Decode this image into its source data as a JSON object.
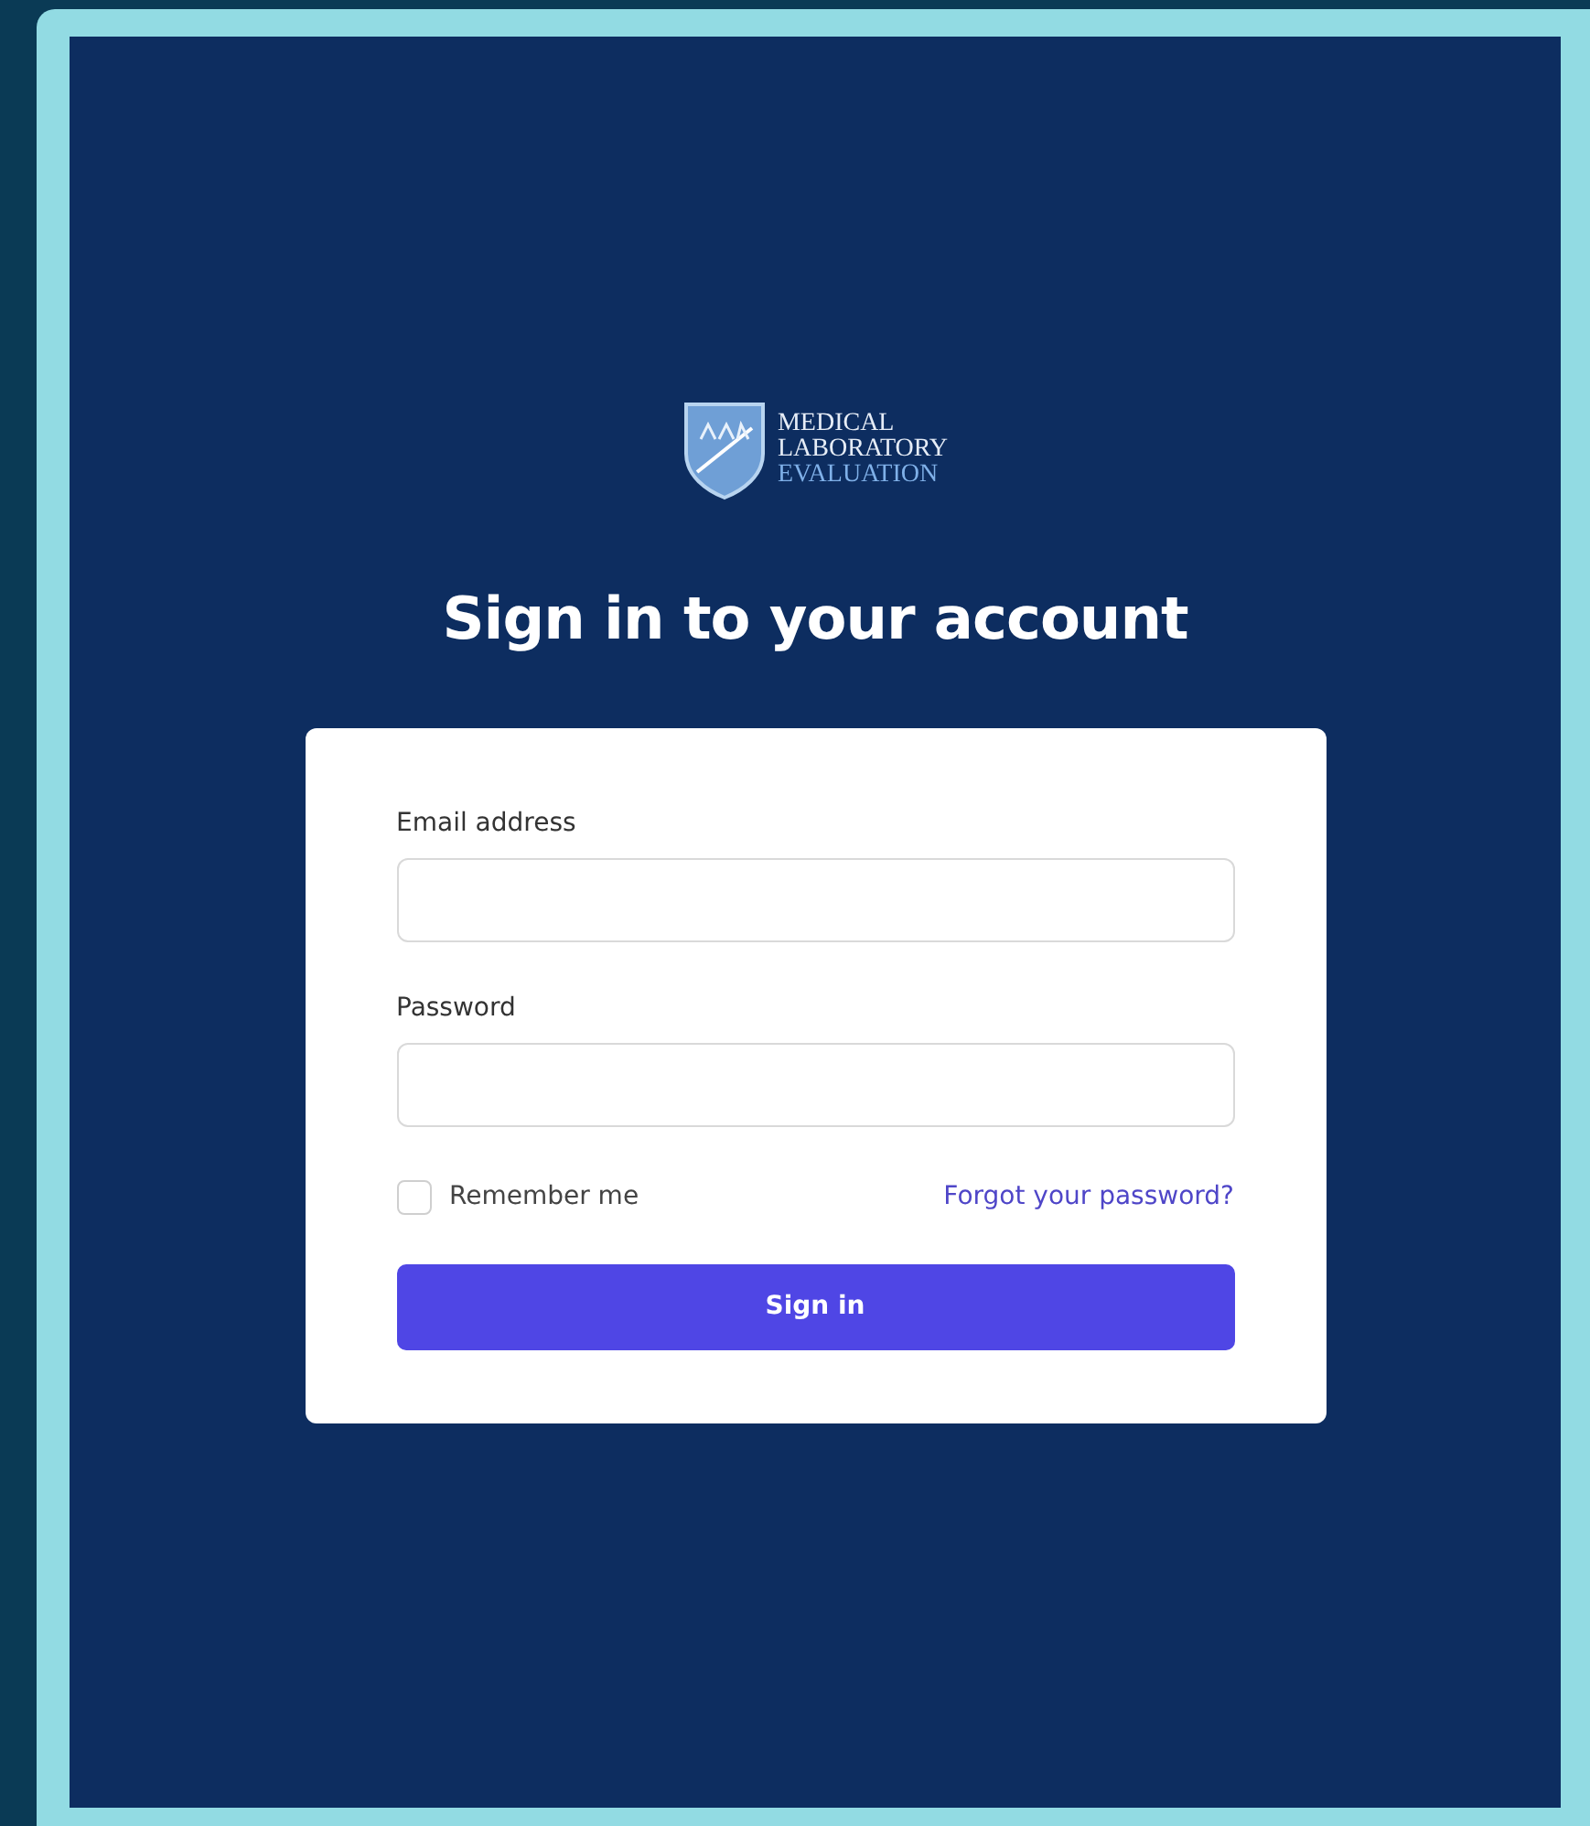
{
  "logo": {
    "lines": [
      "MEDICAL",
      "LABORATORY",
      "EVALUATION"
    ]
  },
  "title": "Sign in to your account",
  "form": {
    "fields": [
      {
        "label": "Email address"
      },
      {
        "label": "Password"
      }
    ],
    "remember": {
      "label": "Remember me",
      "checked": false
    },
    "forgot_link": "Forgot your password?",
    "submit": "Sign in"
  }
}
